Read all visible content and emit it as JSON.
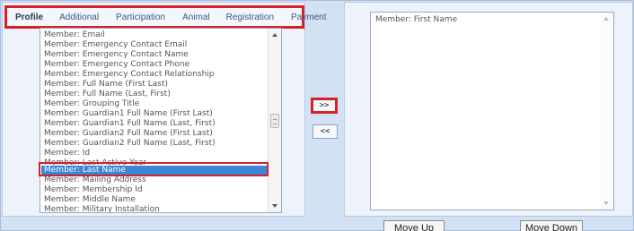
{
  "tabs": [
    {
      "label": "Profile"
    },
    {
      "label": "Additional"
    },
    {
      "label": "Participation"
    },
    {
      "label": "Animal"
    },
    {
      "label": "Registration"
    },
    {
      "label": "Payment"
    }
  ],
  "available_fields": [
    "Member: Email",
    "Member: Emergency Contact Email",
    "Member: Emergency Contact Name",
    "Member: Emergency Contact Phone",
    "Member: Emergency Contact Relationship",
    "Member: Full Name (First Last)",
    "Member: Full Name (Last, First)",
    "Member: Grouping Title",
    "Member: Guardian1 Full Name (First Last)",
    "Member: Guardian1 Full Name (Last, First)",
    "Member: Guardian2 Full Name (First Last)",
    "Member: Guardian2 Full Name (Last, First)",
    "Member: Id",
    "Member: Last Active Year",
    "Member: Last Name",
    "Member: Mailing Address",
    "Member: Membership Id",
    "Member: Middle Name",
    "Member: Military Installation"
  ],
  "selected_available": "Member: Last Name",
  "selected_fields": [
    "Member: First Name"
  ],
  "buttons": {
    "add": ">>",
    "remove": "<<",
    "move_up": "Move Up",
    "move_down": "Move Down"
  },
  "colors": {
    "highlight_outline": "#d3222a",
    "selection": "#3b86d6",
    "panel_bg": "#d3e1f5"
  }
}
